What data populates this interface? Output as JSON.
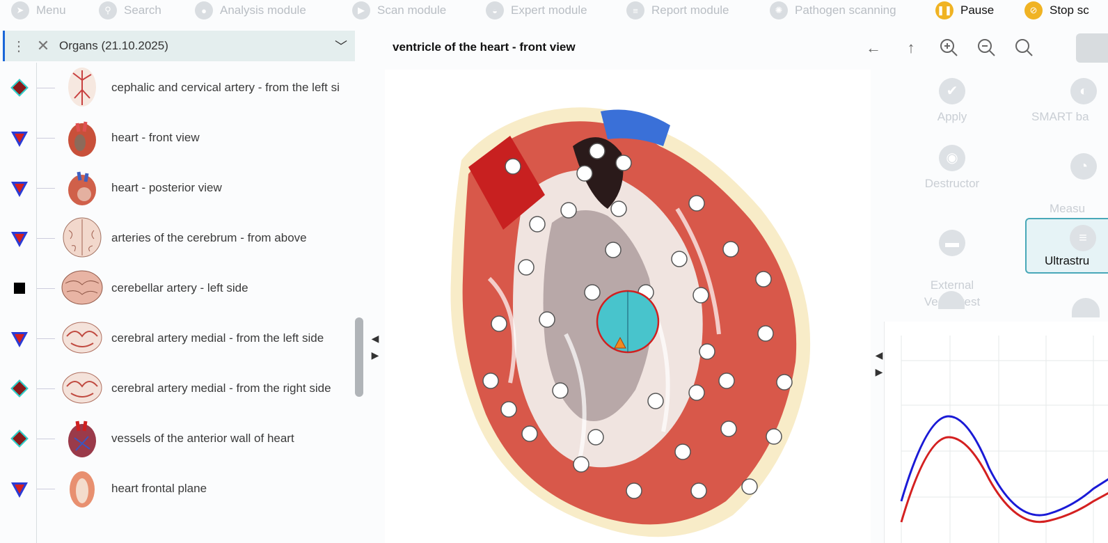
{
  "toolbar": {
    "items": [
      {
        "label": "Menu",
        "icon": "arrow-icon",
        "active": false
      },
      {
        "label": "Search",
        "icon": "search-icon",
        "active": false
      },
      {
        "label": "Analysis module",
        "icon": "analysis-icon",
        "active": false
      },
      {
        "label": "Scan module",
        "icon": "play-icon",
        "active": false
      },
      {
        "label": "Expert module",
        "icon": "expert-icon",
        "active": false
      },
      {
        "label": "Report module",
        "icon": "report-icon",
        "active": false
      },
      {
        "label": "Pathogen scanning",
        "icon": "pathogen-icon",
        "active": false
      },
      {
        "label": "Pause",
        "icon": "pause-icon",
        "active": true
      },
      {
        "label": "Stop sc",
        "icon": "stop-icon",
        "active": true
      }
    ]
  },
  "left_panel": {
    "title": "Organs (21.10.2025)",
    "items": [
      {
        "label": "cephalic and cervical artery - from the left si",
        "marker": "diamond"
      },
      {
        "label": "heart - front view",
        "marker": "triangle"
      },
      {
        "label": "heart - posterior view",
        "marker": "triangle"
      },
      {
        "label": "arteries of the cerebrum - from above",
        "marker": "triangle"
      },
      {
        "label": "cerebellar artery - left side",
        "marker": "square"
      },
      {
        "label": "cerebral artery medial - from the left side",
        "marker": "triangle"
      },
      {
        "label": "cerebral artery medial - from the right side",
        "marker": "diamond"
      },
      {
        "label": "vessels of the anterior wall of heart",
        "marker": "diamond"
      },
      {
        "label": "heart frontal plane",
        "marker": "triangle"
      }
    ]
  },
  "center": {
    "title": "ventricle of the heart - front view"
  },
  "right_panel": {
    "buttons": [
      {
        "label": "Apply",
        "icon": "check-icon"
      },
      {
        "label": "SMART ba",
        "icon": "smart-icon"
      },
      {
        "label": "Destructor",
        "icon": "destructor-icon"
      },
      {
        "label": "Measu\npoints",
        "icon": "measure-icon"
      },
      {
        "label": "External\nVegetotest",
        "icon": "vegetotest-icon"
      },
      {
        "label": "Ultrastru",
        "icon": "ultrastructure-icon"
      }
    ]
  },
  "colors": {
    "accent": "#f0b323",
    "blue_curve": "#1a1ad6",
    "red_curve": "#d42020",
    "selected_outline": "#48a8b8"
  }
}
